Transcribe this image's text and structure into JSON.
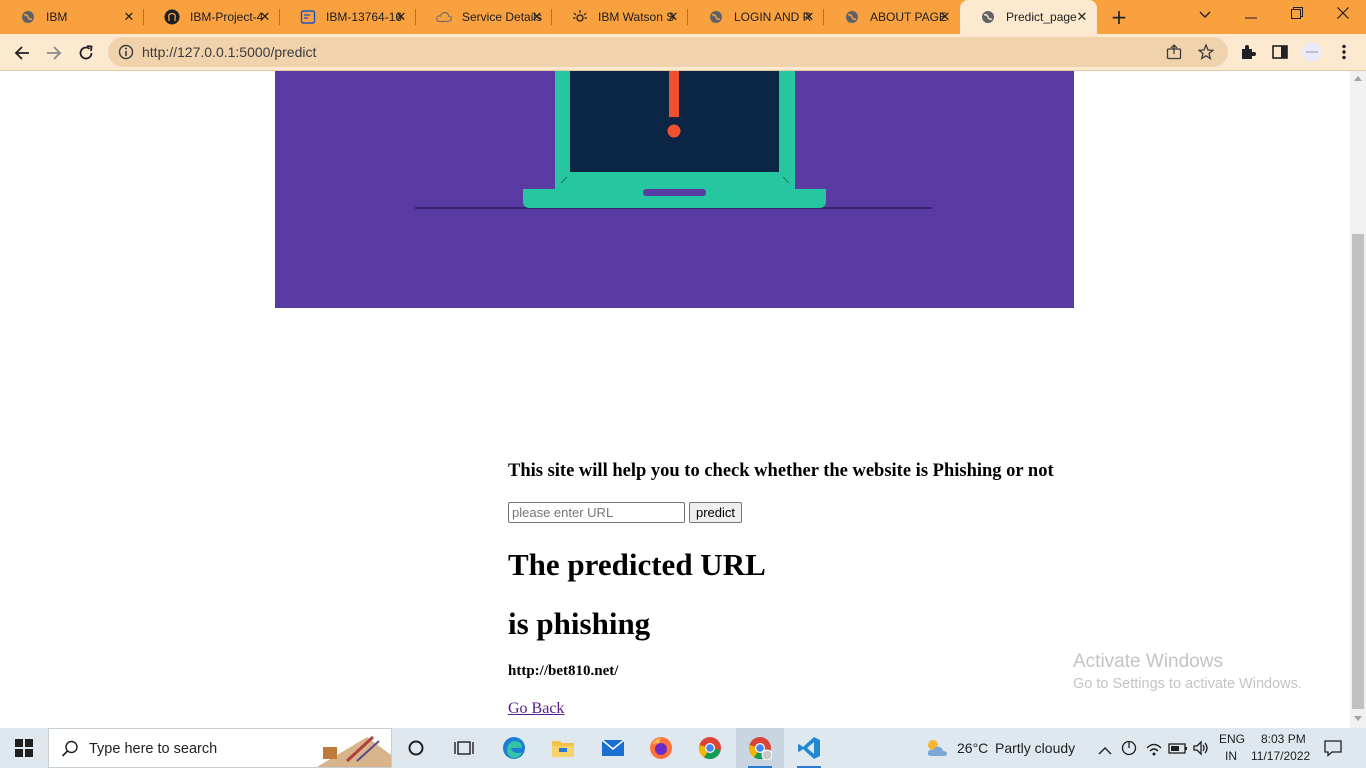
{
  "browser": {
    "tabs": [
      {
        "label": "IBM",
        "icon": "globe-icon"
      },
      {
        "label": "IBM-Project-4",
        "icon": "github-icon"
      },
      {
        "label": "IBM-13764-16",
        "icon": "doc-icon"
      },
      {
        "label": "Service Details",
        "icon": "cloud-icon"
      },
      {
        "label": "IBM Watson S",
        "icon": "watson-icon"
      },
      {
        "label": "LOGIN AND R",
        "icon": "globe-icon"
      },
      {
        "label": "ABOUT PAGE",
        "icon": "globe-icon"
      },
      {
        "label": "Predict_page",
        "icon": "globe-icon",
        "active": true
      }
    ],
    "url": "http://127.0.0.1:5000/predict"
  },
  "page": {
    "subtitle": "This site will help you to check whether the website is Phishing or not",
    "url_input_placeholder": "please enter URL",
    "url_input_value": "",
    "predict_button": "predict",
    "result_heading_line1": "The predicted URL",
    "result_heading_line2": "is phishing",
    "tested_url": "http://bet810.net/",
    "go_back_link": "Go Back"
  },
  "watermark": {
    "line1": "Activate Windows",
    "line2": "Go to Settings to activate Windows."
  },
  "taskbar": {
    "search_placeholder": "Type here to search",
    "weather_temp": "26°C",
    "weather_desc": "Partly cloudy",
    "language": "ENG",
    "region": "IN",
    "time": "8:03 PM",
    "date": "11/17/2022"
  },
  "colors": {
    "tabstrip": "#f9a03f",
    "toolbar": "#fde9cf",
    "hero_bg": "#5a3aa3",
    "laptop": "#25c6a0",
    "screen": "#0b2545",
    "alert": "#f0502e"
  }
}
